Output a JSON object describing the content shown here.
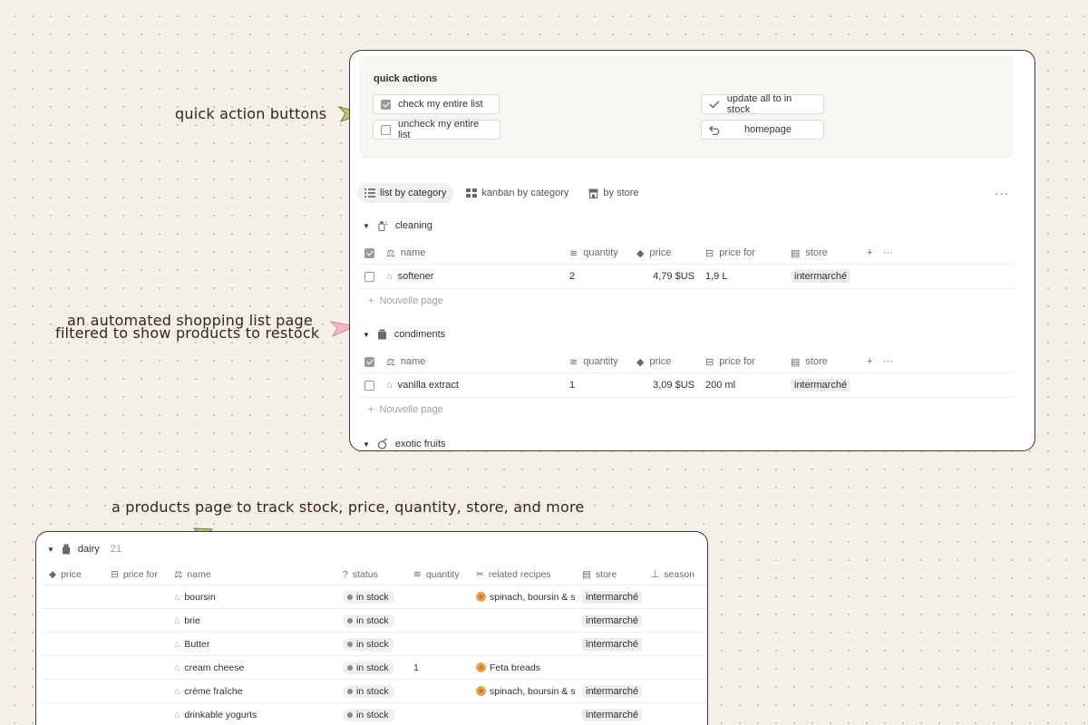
{
  "annotations": {
    "quick_actions": "quick action buttons",
    "shopping_list_line1": "an automated shopping list page",
    "shopping_list_line2": "filtered to show products to restock",
    "products_page": "a products page to track stock, price, quantity, store, and more"
  },
  "quick_actions": {
    "title": "quick actions",
    "buttons": [
      {
        "label": "check my entire list",
        "icon": "checked-checkbox-icon"
      },
      {
        "label": "uncheck my entire list",
        "icon": "empty-checkbox-icon"
      },
      {
        "label": "update all to in stock",
        "icon": "checkmark-icon"
      },
      {
        "label": "homepage",
        "icon": "undo-arrow-icon"
      }
    ]
  },
  "views": [
    {
      "label": "list by category",
      "icon": "list-icon",
      "active": true
    },
    {
      "label": "kanban by category",
      "icon": "board-icon",
      "active": false
    },
    {
      "label": "by store",
      "icon": "store-icon",
      "active": false
    }
  ],
  "list_columns": [
    "name",
    "quantity",
    "price",
    "price for",
    "store"
  ],
  "groups": [
    {
      "name": "cleaning",
      "items": [
        {
          "name": "softener",
          "quantity": "2",
          "price": "4,79 $US",
          "price_for": "1,9 L",
          "store": "intermarché"
        }
      ],
      "new_page": "Nouvelle page"
    },
    {
      "name": "condiments",
      "items": [
        {
          "name": "vanilla extract",
          "quantity": "1",
          "price": "3,09 $US",
          "price_for": "200 ml",
          "store": "intermarché"
        }
      ],
      "new_page": "Nouvelle page"
    },
    {
      "name": "exotic fruits"
    }
  ],
  "products": {
    "group_name": "dairy",
    "group_count": "21",
    "columns": [
      "price",
      "price for",
      "name",
      "status",
      "quantity",
      "related recipes",
      "store",
      "season"
    ],
    "rows": [
      {
        "name": "boursin",
        "status": "in stock",
        "quantity": "",
        "recipe": "spinach, boursin & s",
        "store": "intermarché"
      },
      {
        "name": "brie",
        "status": "in stock",
        "quantity": "",
        "recipe": "",
        "store": "intermarché"
      },
      {
        "name": "Butter",
        "status": "in stock",
        "quantity": "",
        "recipe": "",
        "store": "intermarché"
      },
      {
        "name": "cream cheese",
        "status": "in stock",
        "quantity": "1",
        "recipe": "Feta breads",
        "store": ""
      },
      {
        "name": "crème fraîche",
        "status": "in stock",
        "quantity": "",
        "recipe": "spinach, boursin & s",
        "store": "intermarché"
      },
      {
        "name": "drinkable yogurts",
        "status": "in stock",
        "quantity": "",
        "recipe": "",
        "store": "intermarché"
      }
    ]
  },
  "colors": {
    "background": "#f4f0e8",
    "annotation_text": "#3d2316",
    "arrow_green": "#b9c77e",
    "arrow_pink": "#f2b8c6"
  }
}
